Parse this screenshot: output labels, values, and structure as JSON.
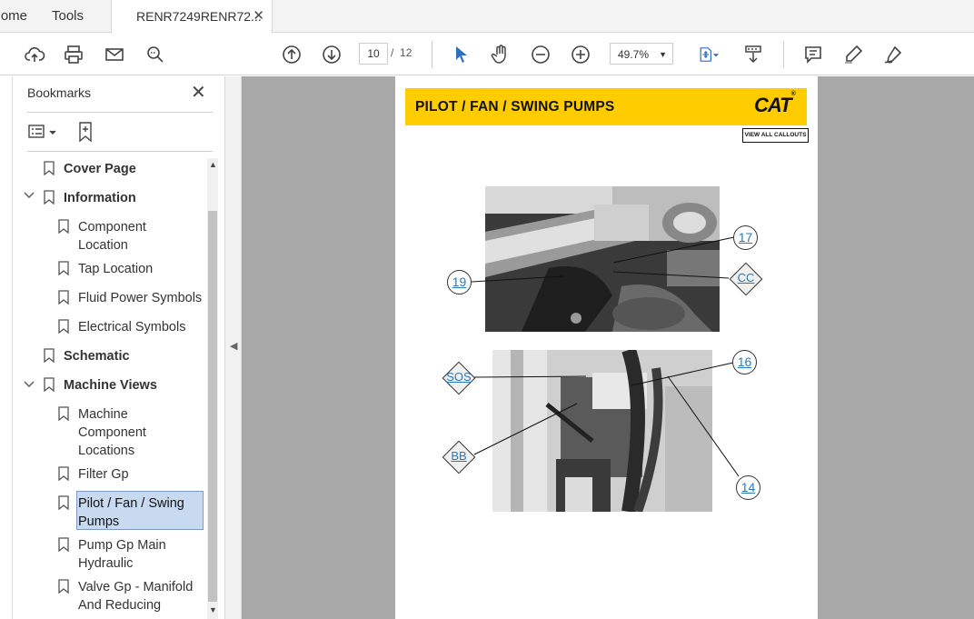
{
  "tabs": {
    "home": "Home",
    "tools": "Tools",
    "document": "RENR7249RENR72...",
    "close_glyph": "✕"
  },
  "toolbar": {
    "current_page": "10",
    "page_separator": "/",
    "total_pages": "12",
    "zoom": "49.7%"
  },
  "bookmarks": {
    "title": "Bookmarks",
    "close_glyph": "✕",
    "items": [
      {
        "label": "Cover Page"
      },
      {
        "label": "Information"
      },
      {
        "label": "Component Location"
      },
      {
        "label": "Tap Location"
      },
      {
        "label": "Fluid Power Symbols"
      },
      {
        "label": "Electrical Symbols"
      },
      {
        "label": "Schematic"
      },
      {
        "label": "Machine Views"
      },
      {
        "label": "Machine Component Locations"
      },
      {
        "label": "Filter Gp"
      },
      {
        "label": "Pilot / Fan / Swing Pumps"
      },
      {
        "label": "Pump Gp Main Hydraulic"
      },
      {
        "label": "Valve Gp - Manifold And Reducing"
      }
    ],
    "selected_index": 10
  },
  "document": {
    "banner_title": "PILOT / FAN  / SWING PUMPS",
    "logo": "CAT",
    "logo_mark": "®",
    "view_all_callouts": "VIEW ALL CALLOUTS",
    "callouts": {
      "c17": "17",
      "c19": "19",
      "cCC": "CC",
      "c16": "16",
      "cSOS": "SOS",
      "cBB": "BB",
      "c14": "14"
    }
  },
  "colors": {
    "banner": "#ffcc00",
    "link": "#2a7ab8",
    "selection": "#c8daf0",
    "doc_background": "#a8a8a8"
  }
}
